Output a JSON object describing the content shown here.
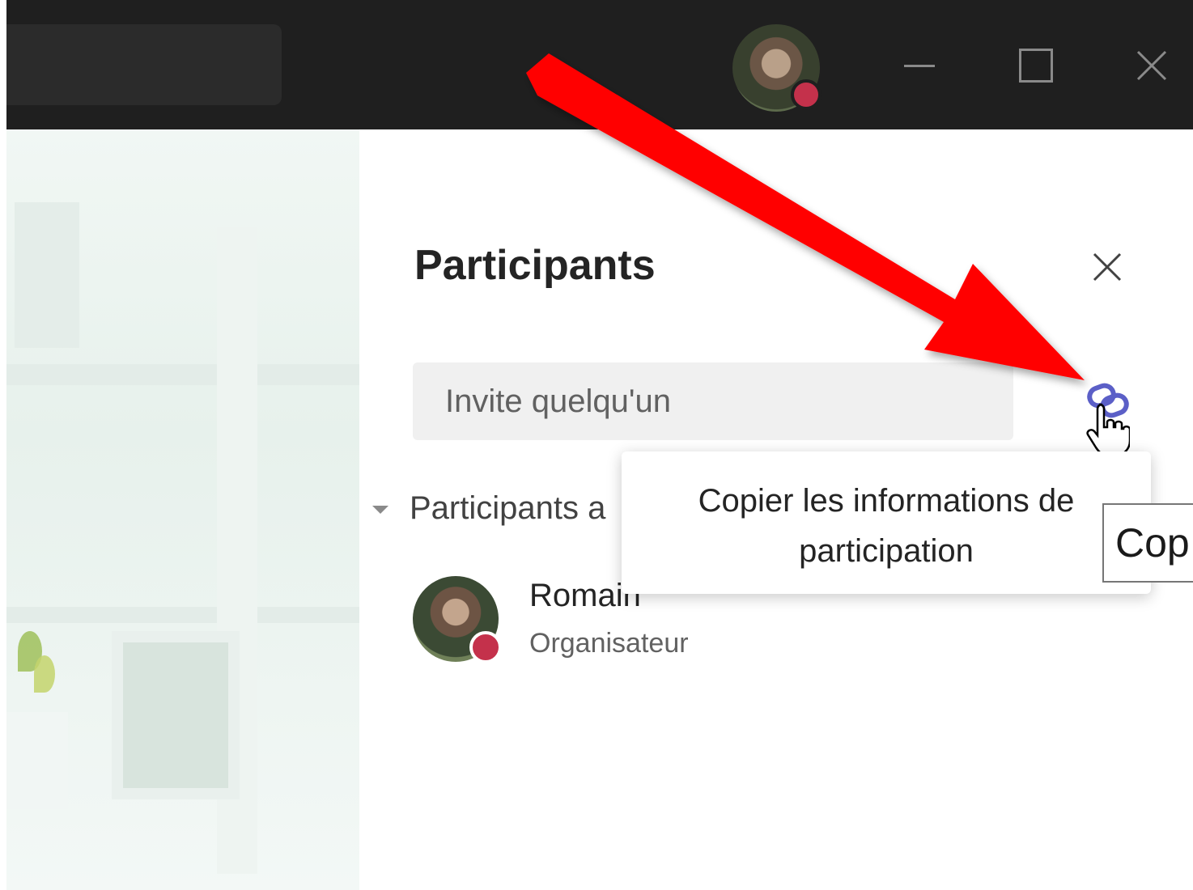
{
  "titlebar": {
    "window_controls": [
      "minimize",
      "maximize",
      "close"
    ]
  },
  "panel": {
    "title": "Participants",
    "invite_placeholder": "Invite quelqu'un",
    "section_label": "Participants a",
    "participant": {
      "name": "Romain",
      "role": "Organisateur"
    }
  },
  "tooltip": {
    "line1": "Copier les informations de",
    "line2": "participation"
  },
  "native_tooltip": "Cop",
  "colors": {
    "titlebar": "#1f1f1f",
    "presence_busy": "#c4314b",
    "link_icon": "#5b5fc7",
    "annotation_arrow": "#ff0000"
  },
  "icons": [
    "avatar",
    "minimize-icon",
    "maximize-icon",
    "close-icon",
    "link-icon",
    "hand-cursor-icon",
    "caret-down-icon",
    "presence-busy-icon"
  ]
}
